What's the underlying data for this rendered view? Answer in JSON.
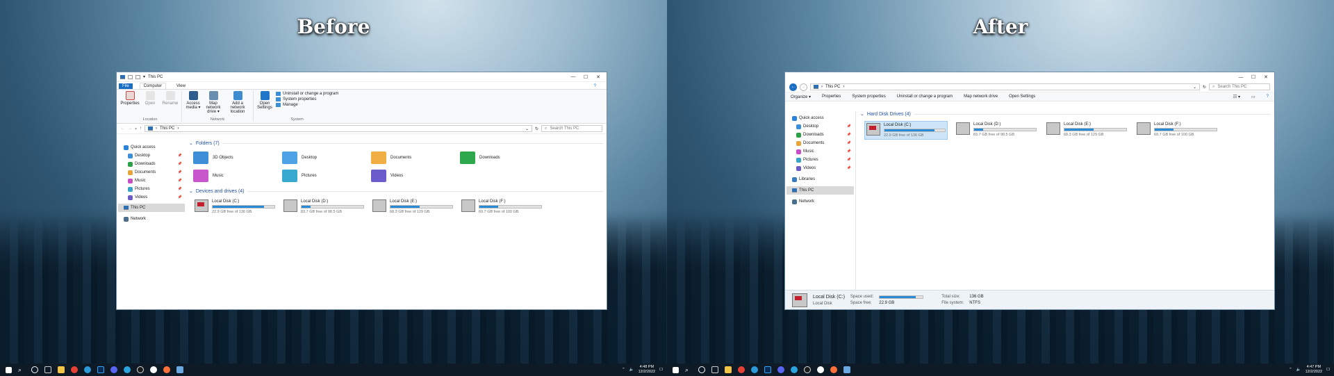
{
  "before": {
    "heading": "Before",
    "window_title": "This PC",
    "ribbon_tabs": [
      "File",
      "Computer",
      "View"
    ],
    "location_group": {
      "label": "Location",
      "commands": [
        "Properties",
        "Open",
        "Rename"
      ]
    },
    "network_group": {
      "label": "Network",
      "commands": [
        "Access media ▾",
        "Map network drive ▾",
        "Add a network location"
      ]
    },
    "system_group": {
      "label": "System",
      "open_settings": "Open Settings",
      "links": [
        "Uninstall or change a program",
        "System properties",
        "Manage"
      ]
    },
    "address_path": "This PC",
    "search_placeholder": "Search This PC",
    "nav": {
      "quick_access": "Quick access",
      "items": [
        "Desktop",
        "Downloads",
        "Documents",
        "Music",
        "Pictures",
        "Videos"
      ],
      "this_pc": "This PC",
      "network": "Network"
    },
    "folders_header": "Folders (7)",
    "folders": [
      "3D Objects",
      "Desktop",
      "Documents",
      "Downloads",
      "Music",
      "Pictures",
      "Videos"
    ],
    "drives_header": "Devices and drives (4)",
    "drives": [
      {
        "name": "Local Disk (C:)",
        "free": "22.9 GB free of 136 GB",
        "used": 0.83
      },
      {
        "name": "Local Disk (D:)",
        "free": "83.7 GB free of 98.5 GB",
        "used": 0.15
      },
      {
        "name": "Local Disk (E:)",
        "free": "68.3 GB free of 129 GB",
        "used": 0.47
      },
      {
        "name": "Local Disk (F:)",
        "free": "69.7 GB free of 100 GB",
        "used": 0.3
      }
    ],
    "clock": {
      "time": "4:48 PM",
      "date": "12/2/2022"
    }
  },
  "after": {
    "heading": "After",
    "address_path": "This PC",
    "search_placeholder": "Search This PC",
    "toolbar": [
      "Organize ▾",
      "Properties",
      "System properties",
      "Uninstall or change a program",
      "Map network drive",
      "Open Settings"
    ],
    "nav": {
      "quick_access": "Quick access",
      "items": [
        "Desktop",
        "Downloads",
        "Documents",
        "Music",
        "Pictures",
        "Videos"
      ],
      "libraries": "Libraries",
      "this_pc": "This PC",
      "network": "Network"
    },
    "drives_header": "Hard Disk Drives (4)",
    "drives": [
      {
        "name": "Local Disk (C:)",
        "free": "22.9 GB free of 136 GB",
        "used": 0.83
      },
      {
        "name": "Local Disk (D:)",
        "free": "83.7 GB free of 98.5 GB",
        "used": 0.15
      },
      {
        "name": "Local Disk (E:)",
        "free": "68.3 GB free of 129 GB",
        "used": 0.47
      },
      {
        "name": "Local Disk (F:)",
        "free": "69.7 GB free of 100 GB",
        "used": 0.3
      }
    ],
    "details": {
      "name": "Local Disk (C:)",
      "type": "Local Disk",
      "space_used_label": "Space used:",
      "space_free_label": "Space free:",
      "space_free": "22.9 GB",
      "total_size_label": "Total size:",
      "total_size": "136 GB",
      "file_system_label": "File system:",
      "file_system": "NTFS",
      "used": 0.83
    },
    "clock": {
      "time": "4:47 PM",
      "date": "12/2/2022"
    }
  },
  "colors": {
    "accent": "#1a6fc4",
    "bar": "#2b8ad6",
    "taskbar": "#0e1a26"
  }
}
